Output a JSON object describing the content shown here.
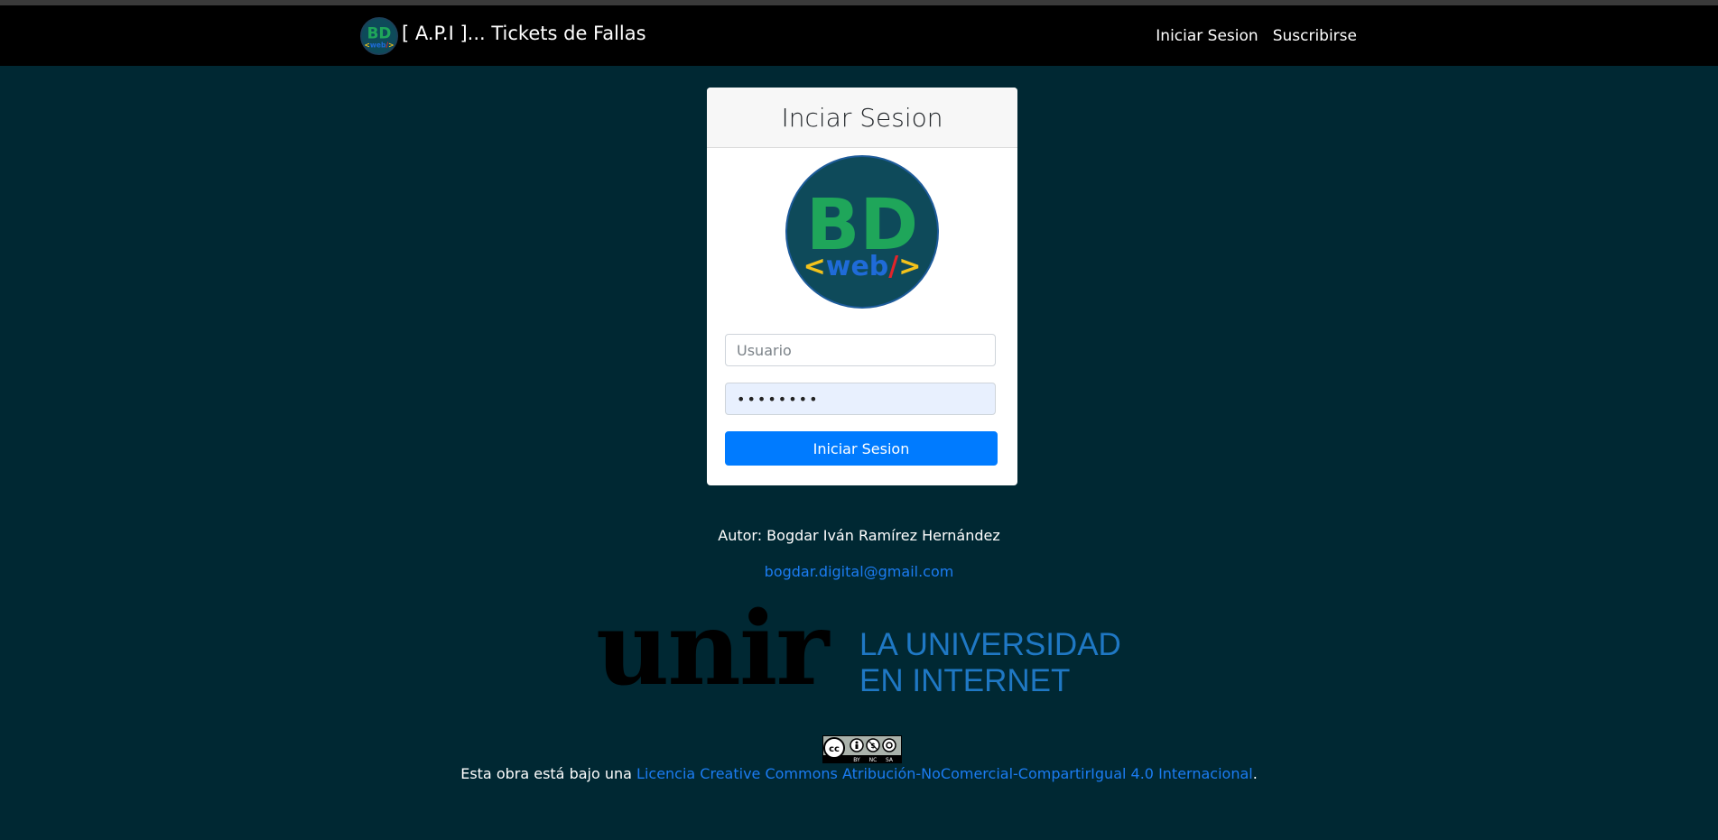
{
  "navbar": {
    "brand_text": "[ A.P.I ]... Tickets de Fallas",
    "links": [
      "Iniciar Sesion",
      "Suscribirse"
    ]
  },
  "login": {
    "title": "Inciar Sesion",
    "username_placeholder": "Usuario",
    "password_value": "••••••••",
    "submit_label": "Iniciar Sesion"
  },
  "logo": {
    "top_text": "BD",
    "bottom_open": "<",
    "bottom_text": "web",
    "bottom_slash": "/",
    "bottom_close": ">",
    "ring_color": "#1d3f59",
    "fill_color": "#0e4a5a",
    "green": "#1fa65a",
    "blue": "#1f6bd8",
    "yellow": "#f2c21b",
    "red": "#e2242a"
  },
  "footer": {
    "author": "Autor: Bogdar Iván Ramírez Hernández",
    "email": "bogdar.digital@gmail.com",
    "unir_word": "unir",
    "unir_tagline_line1": "LA UNIVERSIDAD",
    "unir_tagline_line2": "EN INTERNET",
    "cc_badge_labels": [
      "BY",
      "NC",
      "SA"
    ],
    "license_prefix": "Esta obra está bajo una ",
    "license_link": "Licencia Creative Commons Atribución-NoComercial-CompartirIgual 4.0 Internacional",
    "license_suffix": "."
  }
}
